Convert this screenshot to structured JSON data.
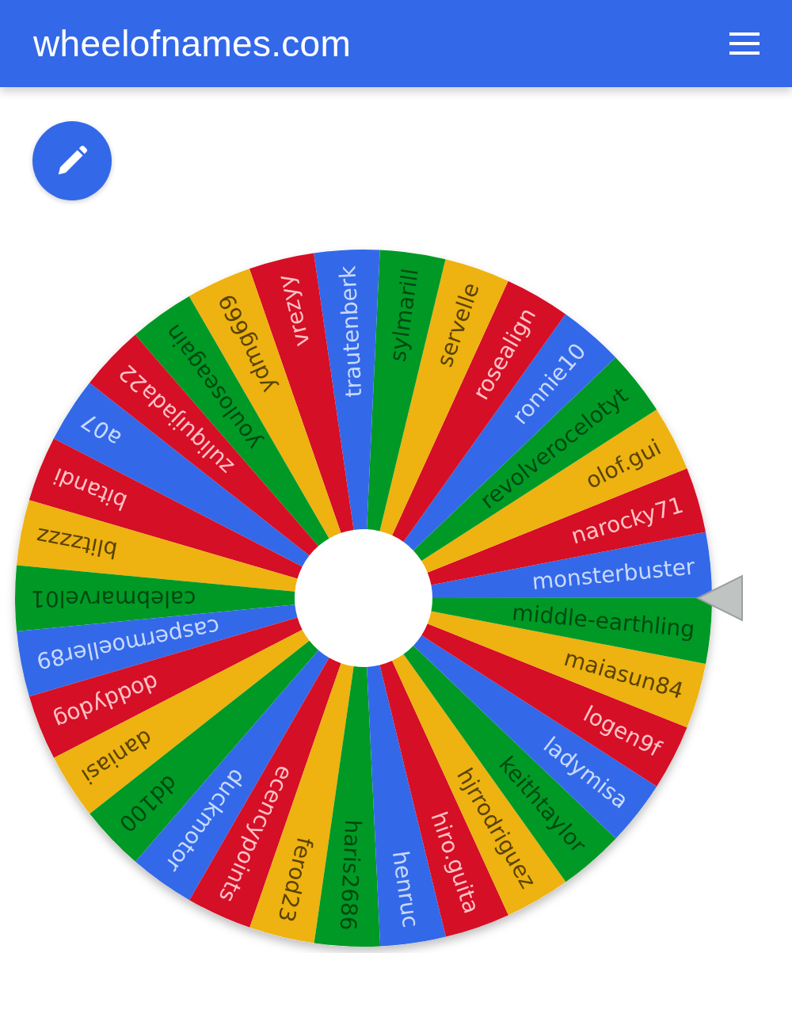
{
  "header": {
    "title": "wheelofnames.com"
  },
  "wheel": {
    "names": [
      {
        "name": "a07",
        "color": "#3369e8"
      },
      {
        "name": "bitandi",
        "color": "#d50f25"
      },
      {
        "name": "blitzzzz",
        "color": "#eeb211"
      },
      {
        "name": "calebmarvel01",
        "color": "#009925"
      },
      {
        "name": "caspermoeller89",
        "color": "#3369e8"
      },
      {
        "name": "doddydog",
        "color": "#d50f25"
      },
      {
        "name": "daniasi",
        "color": "#eeb211"
      },
      {
        "name": "dd100",
        "color": "#009925"
      },
      {
        "name": "duckmotor",
        "color": "#3369e8"
      },
      {
        "name": "ecencypoints",
        "color": "#d50f25"
      },
      {
        "name": "ferod23",
        "color": "#eeb211"
      },
      {
        "name": "haris2686",
        "color": "#009925"
      },
      {
        "name": "henruc",
        "color": "#3369e8"
      },
      {
        "name": "hiro.guita",
        "color": "#d50f25"
      },
      {
        "name": "hjrrodriguez",
        "color": "#eeb211"
      },
      {
        "name": "keithtaylor",
        "color": "#009925"
      },
      {
        "name": "ladymisa",
        "color": "#3369e8"
      },
      {
        "name": "logen9f",
        "color": "#d50f25"
      },
      {
        "name": "maiasun84",
        "color": "#eeb211"
      },
      {
        "name": "middle-earthling",
        "color": "#009925"
      },
      {
        "name": "monsterbuster",
        "color": "#3369e8"
      },
      {
        "name": "narocky71",
        "color": "#d50f25"
      },
      {
        "name": "olof.gui",
        "color": "#eeb211"
      },
      {
        "name": "revolverocelotyt",
        "color": "#009925"
      },
      {
        "name": "ronnie10",
        "color": "#3369e8"
      },
      {
        "name": "rosealign",
        "color": "#d50f25"
      },
      {
        "name": "servelle",
        "color": "#eeb211"
      },
      {
        "name": "sylmarill",
        "color": "#009925"
      },
      {
        "name": "trautenberk",
        "color": "#3369e8"
      },
      {
        "name": "vrezyy",
        "color": "#d50f25"
      },
      {
        "name": "ydmg669",
        "color": "#eeb211"
      },
      {
        "name": "youloseagain",
        "color": "#009925"
      },
      {
        "name": "zuliquijada22",
        "color": "#d50f25"
      }
    ]
  }
}
